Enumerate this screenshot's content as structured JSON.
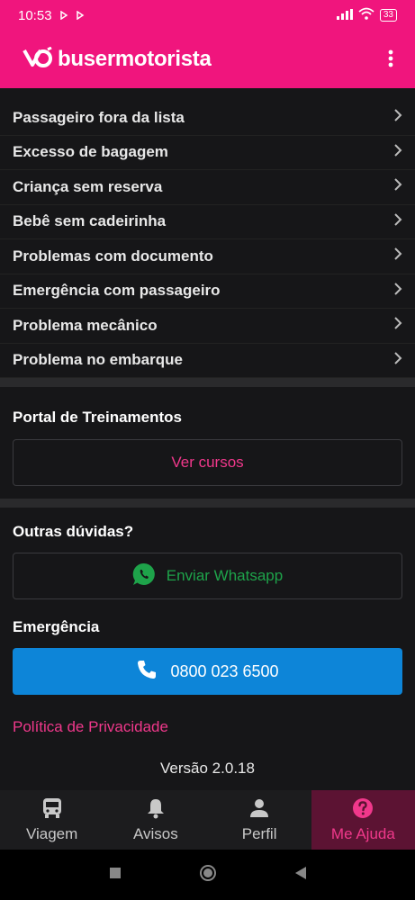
{
  "status_bar": {
    "time": "10:53",
    "battery": "33"
  },
  "app_bar": {
    "logo_text": "busermotorista"
  },
  "help_items": [
    {
      "label": "Passageiro fora da lista"
    },
    {
      "label": "Excesso de bagagem"
    },
    {
      "label": "Criança sem reserva"
    },
    {
      "label": "Bebê sem cadeirinha"
    },
    {
      "label": "Problemas com documento"
    },
    {
      "label": "Emergência com passageiro"
    },
    {
      "label": "Problema mecânico"
    },
    {
      "label": "Problema no embarque"
    }
  ],
  "training": {
    "title": "Portal de Treinamentos",
    "button": "Ver cursos"
  },
  "other_questions": {
    "title": "Outras dúvidas?",
    "whatsapp_button": "Enviar Whatsapp"
  },
  "emergency": {
    "title": "Emergência",
    "phone": "0800 023 6500"
  },
  "privacy_link": "Política de Privacidade",
  "version": "Versão 2.0.18",
  "bottom_nav": [
    {
      "label": "Viagem",
      "icon": "bus-icon"
    },
    {
      "label": "Avisos",
      "icon": "bell-icon"
    },
    {
      "label": "Perfil",
      "icon": "person-icon"
    },
    {
      "label": "Me Ajuda",
      "icon": "help-icon",
      "active": true
    }
  ],
  "colors": {
    "brand_pink": "#f0157d",
    "link_pink": "#f0388b",
    "whatsapp_green": "#1ea34a",
    "call_blue": "#0d85d8"
  }
}
